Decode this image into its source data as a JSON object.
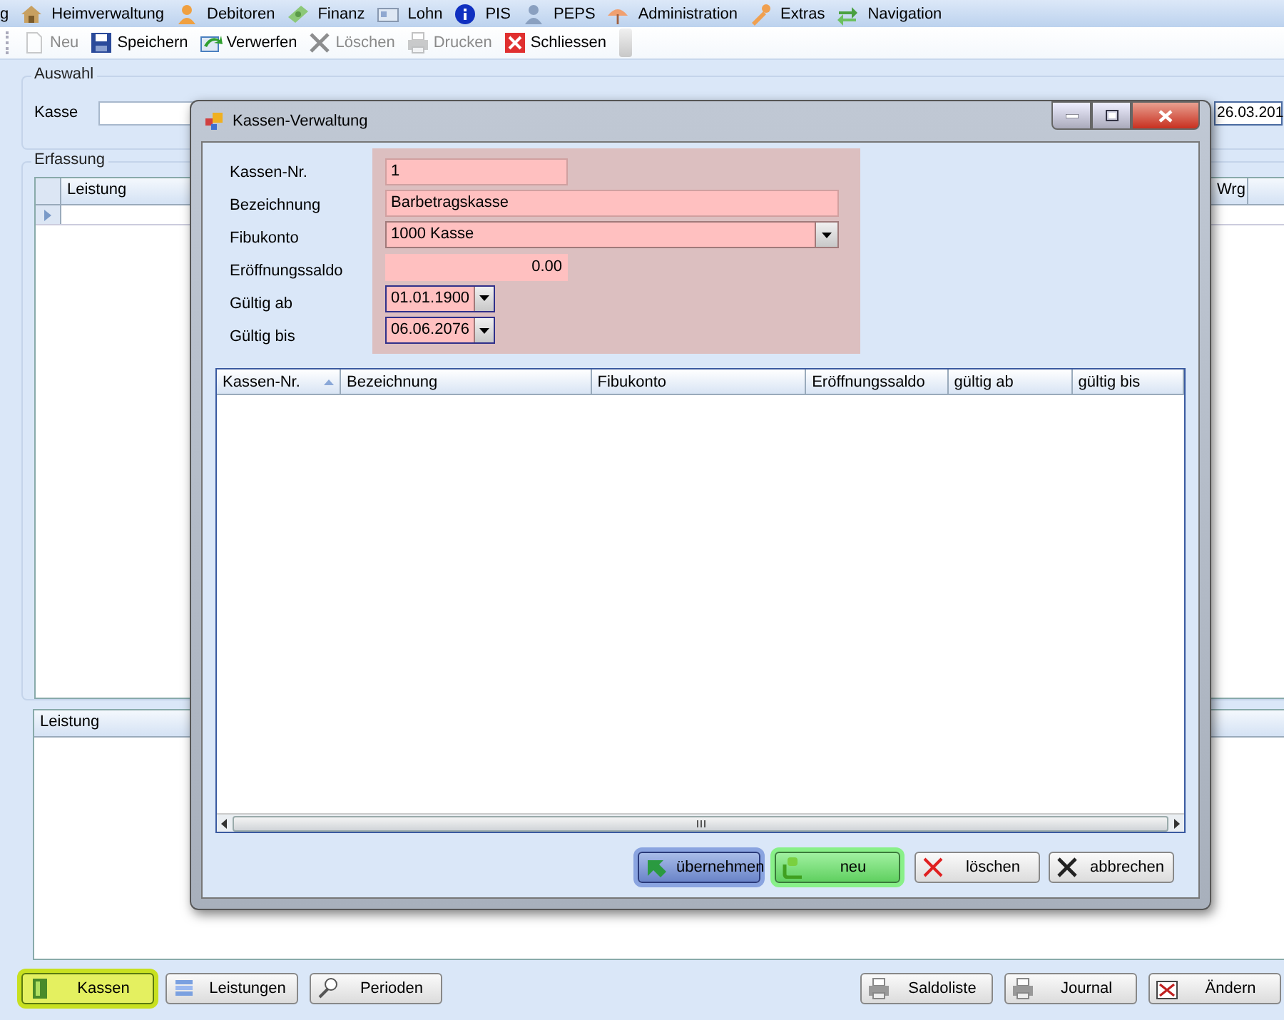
{
  "menu": [
    {
      "label": "g"
    },
    {
      "label": "Heimverwaltung"
    },
    {
      "label": "Debitoren"
    },
    {
      "label": "Finanz"
    },
    {
      "label": "Lohn"
    },
    {
      "label": "PIS"
    },
    {
      "label": "PEPS"
    },
    {
      "label": "Administration"
    },
    {
      "label": "Extras"
    },
    {
      "label": "Navigation"
    }
  ],
  "toolbar": [
    {
      "label": "Neu",
      "disabled": true
    },
    {
      "label": "Speichern",
      "disabled": false
    },
    {
      "label": "Verwerfen",
      "disabled": false
    },
    {
      "label": "Löschen",
      "disabled": true
    },
    {
      "label": "Drucken",
      "disabled": true
    },
    {
      "label": "Schliessen",
      "disabled": false
    }
  ],
  "auswahl": {
    "title": "Auswahl",
    "kasse_label": "Kasse",
    "date_value": "26.03.201"
  },
  "erfassung": {
    "title": "Erfassung",
    "columns": [
      "Leistung",
      "Wrg"
    ]
  },
  "lower_grid": {
    "columns": [
      "Leistung"
    ]
  },
  "dialog": {
    "title": "Kassen-Verwaltung",
    "fields": [
      {
        "label": "Kassen-Nr.",
        "value": "1",
        "kind": "text"
      },
      {
        "label": "Bezeichnung",
        "value": "Barbetragskasse",
        "kind": "wide"
      },
      {
        "label": "Fibukonto",
        "value": "1000 Kasse",
        "kind": "combo"
      },
      {
        "label": "Eröffnungssaldo",
        "value": "0.00",
        "kind": "number"
      },
      {
        "label": "Gültig ab",
        "value": "01.01.1900",
        "kind": "date"
      },
      {
        "label": "Gültig bis",
        "value": "06.06.2076",
        "kind": "date"
      }
    ],
    "columns": [
      {
        "label": "Kassen-Nr.",
        "sorted": true
      },
      {
        "label": "Bezeichnung",
        "sorted": false
      },
      {
        "label": "Fibukonto",
        "sorted": false
      },
      {
        "label": "Eröffnungssaldo",
        "sorted": false
      },
      {
        "label": "gültig ab",
        "sorted": false
      },
      {
        "label": "gültig bis",
        "sorted": false
      }
    ],
    "buttons": [
      {
        "label": "übernehmen",
        "kind": "focused"
      },
      {
        "label": "neu",
        "kind": "highlight"
      },
      {
        "label": "löschen",
        "kind": "plain"
      },
      {
        "label": "abbrechen",
        "kind": "plain"
      }
    ]
  },
  "bottom_buttons": [
    {
      "label": "Kassen",
      "selected": true
    },
    {
      "label": "Leistungen",
      "selected": false
    },
    {
      "label": "Perioden",
      "selected": false
    },
    {
      "label": "Saldoliste",
      "selected": false
    },
    {
      "label": "Journal",
      "selected": false
    },
    {
      "label": "Ändern",
      "selected": false
    }
  ]
}
